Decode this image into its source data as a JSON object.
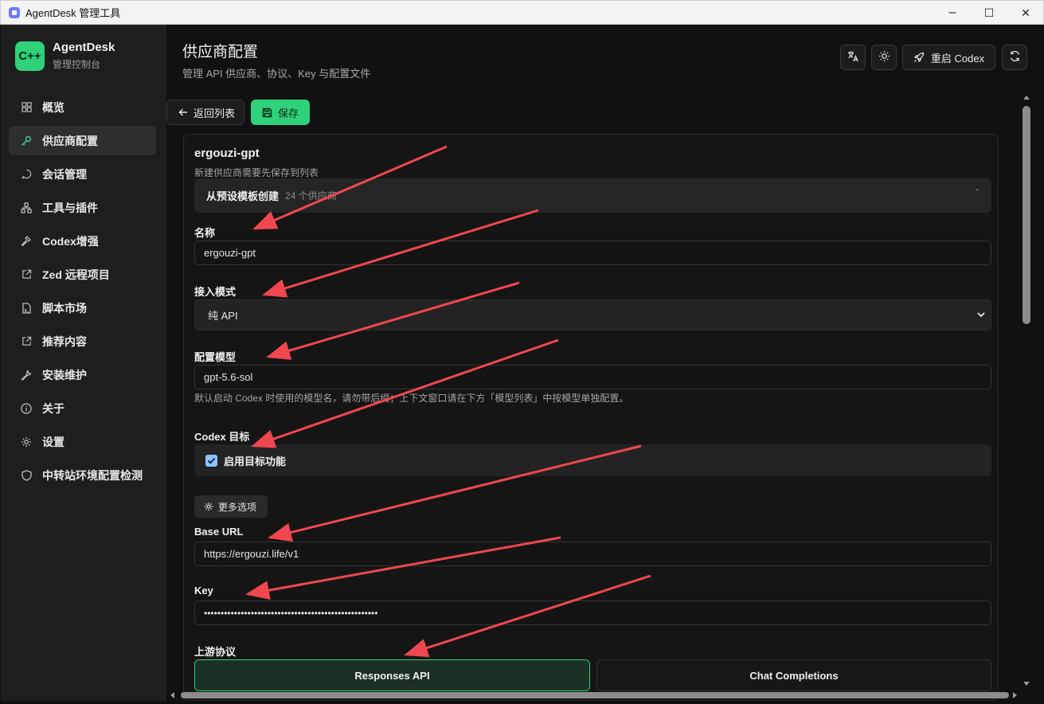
{
  "window": {
    "title": "AgentDesk 管理工具",
    "minimize": "–",
    "maximize": "☐",
    "close": "✕"
  },
  "brand": {
    "logo": "C++",
    "name": "AgentDesk",
    "subtitle": "管理控制台"
  },
  "nav": {
    "items": [
      {
        "label": "概览",
        "icon": "grid-icon"
      },
      {
        "label": "供应商配置",
        "icon": "key-icon",
        "active": true
      },
      {
        "label": "会话管理",
        "icon": "chat-icon"
      },
      {
        "label": "工具与插件",
        "icon": "network-icon"
      },
      {
        "label": "Codex增强",
        "icon": "hammer-icon"
      },
      {
        "label": "Zed 远程项目",
        "icon": "external-link-icon"
      },
      {
        "label": "脚本市场",
        "icon": "script-icon"
      },
      {
        "label": "推荐内容",
        "icon": "external-link-icon"
      },
      {
        "label": "安装维护",
        "icon": "wrench-icon"
      },
      {
        "label": "关于",
        "icon": "info-icon"
      },
      {
        "label": "设置",
        "icon": "gear-icon"
      },
      {
        "label": "中转站环境配置检测",
        "icon": "shield-icon"
      }
    ]
  },
  "header": {
    "title": "供应商配置",
    "subtitle": "管理 API 供应商、协议、Key 与配置文件",
    "restart_label": "重启 Codex"
  },
  "toolbar": {
    "back_label": "返回列表",
    "save_label": "保存"
  },
  "form": {
    "provider_title": "ergouzi-gpt",
    "provider_note": "新建供应商需要先保存到列表",
    "template": {
      "label": "从预设模板创建",
      "count": "24 个供应商"
    },
    "name": {
      "label": "名称",
      "value": "ergouzi-gpt"
    },
    "mode": {
      "label": "接入模式",
      "value": "纯 API"
    },
    "model": {
      "label": "配置模型",
      "value": "gpt-5.6-sol",
      "hint": "默认启动 Codex 时使用的模型名，请勿带后缀；上下文窗口请在下方「模型列表」中按模型单独配置。"
    },
    "codex_target": {
      "label": "Codex 目标",
      "checkbox_label": "启用目标功能",
      "checked": true
    },
    "more_options_label": "更多选项",
    "base_url": {
      "label": "Base URL",
      "value": "https://ergouzi.life/v1"
    },
    "key": {
      "label": "Key",
      "value": "••••••••••••••••••••••••••••••••••••••••••••••••••••"
    },
    "upstream": {
      "label": "上游协议",
      "options": [
        "Responses API",
        "Chat Completions"
      ],
      "selected": "Responses API"
    }
  },
  "colors": {
    "accent": "#2fd27b",
    "arrow": "#f0474f"
  }
}
